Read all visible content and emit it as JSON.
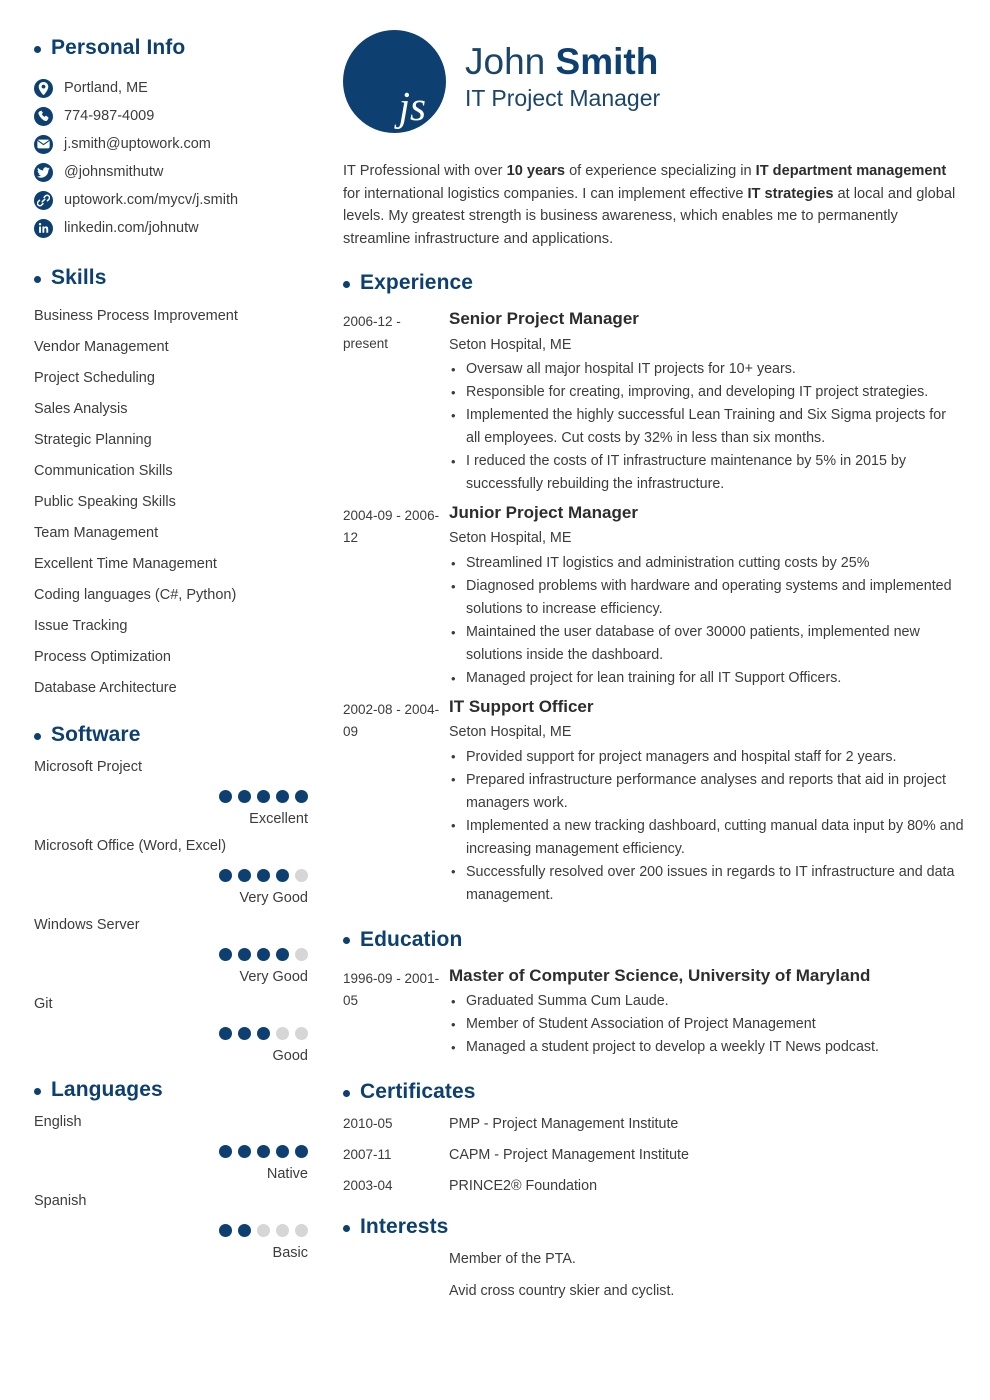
{
  "colors": {
    "navy": "#0d4071",
    "heading_navy": "#1b4568",
    "body_text": "#3c3c3c",
    "dot_empty": "#d6d6d6",
    "page_bg": "#ffffff"
  },
  "header": {
    "monogram": "js",
    "first_name": "John",
    "last_name": "Smith",
    "job_title": "IT Project Manager",
    "summary_parts": [
      {
        "text": "IT Professional with over ",
        "bold": false
      },
      {
        "text": "10 years",
        "bold": true
      },
      {
        "text": " of experience specializing in ",
        "bold": false
      },
      {
        "text": "IT department management",
        "bold": true
      },
      {
        "text": " for international logistics companies. I can implement effective ",
        "bold": false
      },
      {
        "text": "IT strategies",
        "bold": true
      },
      {
        "text": " at local and global levels. My greatest strength is business awareness, which enables me to permanently streamline infrastructure and applications.",
        "bold": false
      }
    ]
  },
  "sidebar": {
    "personal_info": {
      "heading": "Personal Info",
      "contacts": [
        {
          "icon": "location-pin-icon",
          "text": "Portland, ME"
        },
        {
          "icon": "phone-icon",
          "text": "774-987-4009"
        },
        {
          "icon": "email-icon",
          "text": "j.smith@uptowork.com"
        },
        {
          "icon": "twitter-icon",
          "text": "@johnsmithutw"
        },
        {
          "icon": "link-icon",
          "text": "uptowork.com/mycv/j.smith"
        },
        {
          "icon": "linkedin-icon",
          "text": "linkedin.com/johnutw"
        }
      ]
    },
    "skills": {
      "heading": "Skills",
      "items": [
        "Business Process Improvement",
        "Vendor Management",
        "Project Scheduling",
        "Sales Analysis",
        "Strategic Planning",
        "Communication Skills",
        "Public Speaking Skills",
        "Team Management",
        "Excellent Time Management",
        "Coding languages (C#, Python)",
        "Issue Tracking",
        "Process Optimization",
        "Database Architecture"
      ]
    },
    "software": {
      "heading": "Software",
      "max_dots": 5,
      "items": [
        {
          "label": "Microsoft Project",
          "rating": 5,
          "level": "Excellent"
        },
        {
          "label": "Microsoft Office (Word, Excel)",
          "rating": 4,
          "level": "Very Good"
        },
        {
          "label": "Windows Server",
          "rating": 4,
          "level": "Very Good"
        },
        {
          "label": "Git",
          "rating": 3,
          "level": "Good"
        }
      ]
    },
    "languages": {
      "heading": "Languages",
      "max_dots": 5,
      "items": [
        {
          "label": "English",
          "rating": 5,
          "level": "Native"
        },
        {
          "label": "Spanish",
          "rating": 2,
          "level": "Basic"
        }
      ]
    }
  },
  "main": {
    "experience": {
      "heading": "Experience",
      "entries": [
        {
          "date": "2006-12 - present",
          "title": "Senior Project Manager",
          "subtitle": "Seton Hospital, ME",
          "bullets": [
            "Oversaw all major hospital IT projects for 10+ years.",
            "Responsible for creating, improving, and developing IT project strategies.",
            "Implemented the highly successful Lean Training and Six Sigma projects for all employees. Cut costs by 32% in less than six months.",
            "I reduced the costs of IT infrastructure maintenance by 5% in 2015 by successfully rebuilding the infrastructure."
          ]
        },
        {
          "date": "2004-09 - 2006-12",
          "title": "Junior Project Manager",
          "subtitle": "Seton Hospital, ME",
          "bullets": [
            "Streamlined IT logistics and administration cutting costs by 25%",
            "Diagnosed problems with hardware and operating systems and implemented solutions to increase efficiency.",
            "Maintained the user database of over 30000 patients, implemented new solutions inside the dashboard.",
            "Managed project for lean training for all IT Support Officers."
          ]
        },
        {
          "date": "2002-08 - 2004-09",
          "title": "IT Support Officer",
          "subtitle": "Seton Hospital, ME",
          "bullets": [
            "Provided support for project managers and hospital staff for 2 years.",
            "Prepared infrastructure performance analyses and reports that aid in project managers work.",
            "Implemented a new tracking dashboard, cutting manual data input by 80% and increasing management efficiency.",
            "Successfully resolved over 200 issues in regards to IT infrastructure and data management."
          ]
        }
      ]
    },
    "education": {
      "heading": "Education",
      "entries": [
        {
          "date": "1996-09 - 2001-05",
          "title": "Master of Computer Science, University of Maryland",
          "subtitle": "",
          "bullets": [
            "Graduated Summa Cum Laude.",
            "Member of Student Association of Project Management",
            "Managed a student project to develop a weekly IT News podcast."
          ]
        }
      ]
    },
    "certificates": {
      "heading": "Certificates",
      "items": [
        {
          "date": "2010-05",
          "name": "PMP - Project Management Institute"
        },
        {
          "date": "2007-11",
          "name": "CAPM - Project Management Institute"
        },
        {
          "date": "2003-04",
          "name": "PRINCE2® Foundation"
        }
      ]
    },
    "interests": {
      "heading": "Interests",
      "items": [
        "Member of the PTA.",
        "Avid cross country skier and cyclist."
      ]
    }
  }
}
